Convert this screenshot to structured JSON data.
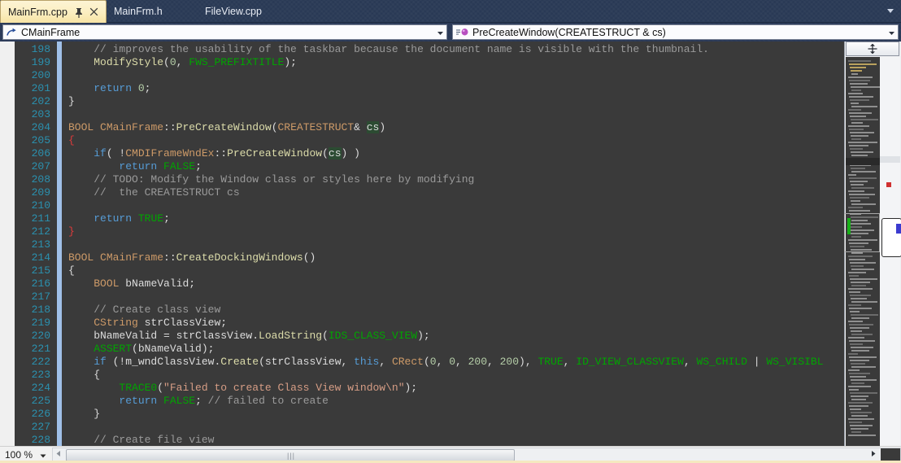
{
  "window": {
    "theme_bg": "#3a3a3a",
    "accent": "#2b3a58"
  },
  "tabs": {
    "items": [
      {
        "label": "MainFrm.cpp",
        "active": true,
        "pin_icon": "pin-icon",
        "close_icon": "close-icon"
      },
      {
        "label": "MainFrm.h",
        "active": false
      },
      {
        "label": "FileView.cpp",
        "active": false
      }
    ],
    "overflow_icon": "chevron-down-icon"
  },
  "navbar": {
    "class_combo": {
      "value": "CMainFrame",
      "icon": "class-icon",
      "caret": "chevron-down-icon"
    },
    "member_combo": {
      "value": "PreCreateWindow(CREATESTRUCT & cs)",
      "icon": "method-icon",
      "caret": "chevron-down-icon"
    }
  },
  "editor": {
    "first_line": 198,
    "lines": [
      {
        "n": 198,
        "outline": "v",
        "tokens": [
          {
            "t": "    ",
            "c": "p"
          },
          {
            "t": "// improves the usability of the taskbar because the document name is visible with the thumbnail.",
            "c": "c"
          }
        ]
      },
      {
        "n": 199,
        "outline": "hook",
        "tokens": [
          {
            "t": "    ",
            "c": "p"
          },
          {
            "t": "ModifyStyle",
            "c": "f"
          },
          {
            "t": "(",
            "c": "p"
          },
          {
            "t": "0",
            "c": "n"
          },
          {
            "t": ", ",
            "c": "p"
          },
          {
            "t": "FWS_PREFIXTITLE",
            "c": "g"
          },
          {
            "t": ");",
            "c": "p"
          }
        ]
      },
      {
        "n": 200,
        "outline": "v",
        "tokens": []
      },
      {
        "n": 201,
        "outline": "v",
        "tokens": [
          {
            "t": "    ",
            "c": "p"
          },
          {
            "t": "return",
            "c": "k"
          },
          {
            "t": " ",
            "c": "p"
          },
          {
            "t": "0",
            "c": "n"
          },
          {
            "t": ";",
            "c": "p"
          }
        ]
      },
      {
        "n": 202,
        "outline": "end",
        "tokens": [
          {
            "t": "}",
            "c": "p"
          }
        ]
      },
      {
        "n": 203,
        "outline": "",
        "tokens": []
      },
      {
        "n": 204,
        "outline": "box",
        "tokens": [
          {
            "t": "BOOL",
            "c": "t"
          },
          {
            "t": " ",
            "c": "p"
          },
          {
            "t": "CMainFrame",
            "c": "t"
          },
          {
            "t": "::",
            "c": "p"
          },
          {
            "t": "PreCreateWindow",
            "c": "f"
          },
          {
            "t": "(",
            "c": "p"
          },
          {
            "t": "CREATESTRUCT",
            "c": "t"
          },
          {
            "t": "& ",
            "c": "p"
          },
          {
            "t": "cs",
            "c": "p hl"
          },
          {
            "t": ")",
            "c": "p"
          }
        ]
      },
      {
        "n": 205,
        "outline": "v",
        "tokens": [
          {
            "t": "{",
            "c": "red"
          }
        ]
      },
      {
        "n": 206,
        "outline": "v",
        "tokens": [
          {
            "t": "    ",
            "c": "p"
          },
          {
            "t": "if",
            "c": "k"
          },
          {
            "t": "( !",
            "c": "p"
          },
          {
            "t": "CMDIFrameWndEx",
            "c": "t"
          },
          {
            "t": "::",
            "c": "p"
          },
          {
            "t": "PreCreateWindow",
            "c": "f"
          },
          {
            "t": "(",
            "c": "p"
          },
          {
            "t": "cs",
            "c": "p hl"
          },
          {
            "t": ") )",
            "c": "p"
          }
        ]
      },
      {
        "n": 207,
        "outline": "v",
        "tokens": [
          {
            "t": "        ",
            "c": "p"
          },
          {
            "t": "return",
            "c": "k"
          },
          {
            "t": " ",
            "c": "p"
          },
          {
            "t": "FALSE",
            "c": "g"
          },
          {
            "t": ";",
            "c": "p"
          }
        ]
      },
      {
        "n": 208,
        "outline": "box2",
        "tokens": [
          {
            "t": "    ",
            "c": "p"
          },
          {
            "t": "// TODO: Modify the Window class or styles here by modifying",
            "c": "c"
          }
        ]
      },
      {
        "n": 209,
        "outline": "hook",
        "tokens": [
          {
            "t": "    ",
            "c": "p"
          },
          {
            "t": "//  the CREATESTRUCT cs",
            "c": "c"
          }
        ]
      },
      {
        "n": 210,
        "outline": "v",
        "tokens": []
      },
      {
        "n": 211,
        "outline": "v",
        "tokens": [
          {
            "t": "    ",
            "c": "p"
          },
          {
            "t": "return",
            "c": "k"
          },
          {
            "t": " ",
            "c": "p"
          },
          {
            "t": "TRUE",
            "c": "g"
          },
          {
            "t": ";",
            "c": "p"
          }
        ]
      },
      {
        "n": 212,
        "outline": "end",
        "tokens": [
          {
            "t": "}",
            "c": "red"
          }
        ]
      },
      {
        "n": 213,
        "outline": "",
        "tokens": []
      },
      {
        "n": 214,
        "outline": "box",
        "tokens": [
          {
            "t": "BOOL",
            "c": "t"
          },
          {
            "t": " ",
            "c": "p"
          },
          {
            "t": "CMainFrame",
            "c": "t"
          },
          {
            "t": "::",
            "c": "p"
          },
          {
            "t": "CreateDockingWindows",
            "c": "f"
          },
          {
            "t": "()",
            "c": "p"
          }
        ]
      },
      {
        "n": 215,
        "outline": "v",
        "tokens": [
          {
            "t": "{",
            "c": "p"
          }
        ]
      },
      {
        "n": 216,
        "outline": "v",
        "tokens": [
          {
            "t": "    ",
            "c": "p"
          },
          {
            "t": "BOOL",
            "c": "t"
          },
          {
            "t": " bNameValid;",
            "c": "p"
          }
        ]
      },
      {
        "n": 217,
        "outline": "v",
        "tokens": []
      },
      {
        "n": 218,
        "outline": "v",
        "tokens": [
          {
            "t": "    ",
            "c": "p"
          },
          {
            "t": "// Create class view",
            "c": "c"
          }
        ]
      },
      {
        "n": 219,
        "outline": "v",
        "tokens": [
          {
            "t": "    ",
            "c": "p"
          },
          {
            "t": "CString",
            "c": "t"
          },
          {
            "t": " strClassView;",
            "c": "p"
          }
        ]
      },
      {
        "n": 220,
        "outline": "v",
        "tokens": [
          {
            "t": "    bNameValid = strClassView.",
            "c": "p"
          },
          {
            "t": "LoadString",
            "c": "f"
          },
          {
            "t": "(",
            "c": "p"
          },
          {
            "t": "IDS_CLASS_VIEW",
            "c": "g"
          },
          {
            "t": ");",
            "c": "p"
          }
        ]
      },
      {
        "n": 221,
        "outline": "v",
        "tokens": [
          {
            "t": "    ",
            "c": "p"
          },
          {
            "t": "ASSERT",
            "c": "g"
          },
          {
            "t": "(bNameValid);",
            "c": "p"
          }
        ]
      },
      {
        "n": 222,
        "outline": "box2",
        "tokens": [
          {
            "t": "    ",
            "c": "p"
          },
          {
            "t": "if",
            "c": "k"
          },
          {
            "t": " (!m_wndClassView.",
            "c": "p"
          },
          {
            "t": "Create",
            "c": "f"
          },
          {
            "t": "(strClassView, ",
            "c": "p"
          },
          {
            "t": "this",
            "c": "k"
          },
          {
            "t": ", ",
            "c": "p"
          },
          {
            "t": "CRect",
            "c": "t"
          },
          {
            "t": "(",
            "c": "p"
          },
          {
            "t": "0",
            "c": "n"
          },
          {
            "t": ", ",
            "c": "p"
          },
          {
            "t": "0",
            "c": "n"
          },
          {
            "t": ", ",
            "c": "p"
          },
          {
            "t": "200",
            "c": "n"
          },
          {
            "t": ", ",
            "c": "p"
          },
          {
            "t": "200",
            "c": "n"
          },
          {
            "t": "), ",
            "c": "p"
          },
          {
            "t": "TRUE",
            "c": "g"
          },
          {
            "t": ", ",
            "c": "p"
          },
          {
            "t": "ID_VIEW_CLASSVIEW",
            "c": "g"
          },
          {
            "t": ", ",
            "c": "p"
          },
          {
            "t": "WS_CHILD",
            "c": "g"
          },
          {
            "t": " | ",
            "c": "p"
          },
          {
            "t": "WS_VISIBL",
            "c": "g"
          }
        ]
      },
      {
        "n": 223,
        "outline": "v",
        "tokens": [
          {
            "t": "    {",
            "c": "p"
          }
        ]
      },
      {
        "n": 224,
        "outline": "v",
        "tokens": [
          {
            "t": "        ",
            "c": "p"
          },
          {
            "t": "TRACE0",
            "c": "g"
          },
          {
            "t": "(",
            "c": "p"
          },
          {
            "t": "\"Failed to create Class View window\\n\"",
            "c": "s"
          },
          {
            "t": ");",
            "c": "p"
          }
        ]
      },
      {
        "n": 225,
        "outline": "v",
        "tokens": [
          {
            "t": "        ",
            "c": "p"
          },
          {
            "t": "return",
            "c": "k"
          },
          {
            "t": " ",
            "c": "p"
          },
          {
            "t": "FALSE",
            "c": "g"
          },
          {
            "t": "; ",
            "c": "p"
          },
          {
            "t": "// failed to create",
            "c": "c"
          }
        ]
      },
      {
        "n": 226,
        "outline": "endin",
        "tokens": [
          {
            "t": "    }",
            "c": "p"
          }
        ]
      },
      {
        "n": 227,
        "outline": "v",
        "tokens": []
      },
      {
        "n": 228,
        "outline": "v",
        "tokens": [
          {
            "t": "    ",
            "c": "p"
          },
          {
            "t": "// Create file view",
            "c": "c"
          }
        ]
      }
    ]
  },
  "scrollbar": {
    "split_view_icon": "split-view-icon",
    "minimap_icon": "minimap",
    "error_marker_color": "#d03030",
    "change_marker_color": "#18b018"
  },
  "statusbar": {
    "zoom": "100 %",
    "zoom_caret": "chevron-down-icon",
    "hscroll_left_icon": "scroll-left-arrow",
    "hscroll_right_icon": "scroll-right-arrow",
    "hscroll_grip": "|||"
  }
}
